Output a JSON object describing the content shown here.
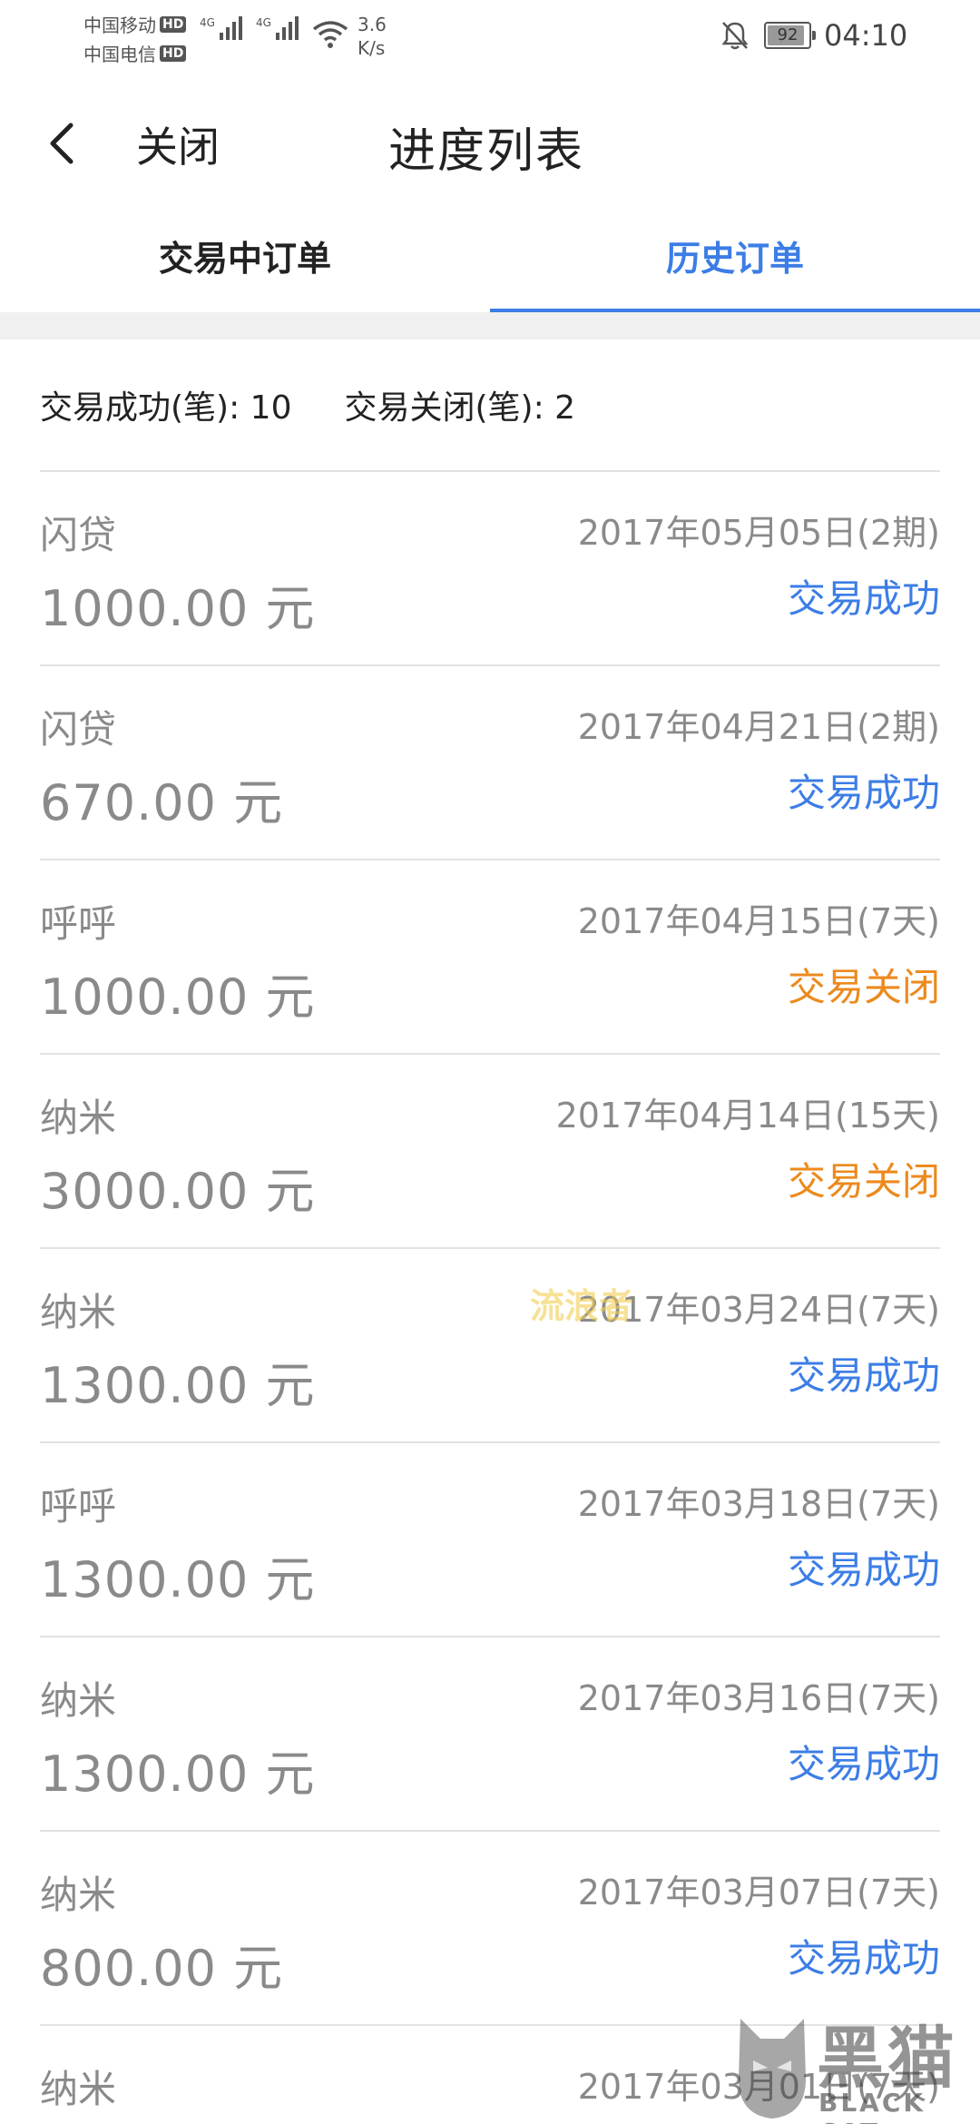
{
  "status_bar": {
    "carrier_1": "中国移动",
    "carrier_2": "中国电信",
    "hd_badge": "HD",
    "network_1": "4G",
    "network_2": "4G",
    "speed_value": "3.6",
    "speed_unit": "K/s",
    "battery": "92",
    "battery_level": 0.92,
    "time": "04:10"
  },
  "header": {
    "close_label": "关闭",
    "title": "进度列表"
  },
  "tabs": [
    {
      "label": "交易中订单",
      "active": false
    },
    {
      "label": "历史订单",
      "active": true
    }
  ],
  "summary": {
    "success_label": "交易成功(笔): 10",
    "closed_label": "交易关闭(笔): 2"
  },
  "orders": [
    {
      "name": "闪贷",
      "date": "2017年05月05日(2期)",
      "amount": "1000.00 元",
      "status": "交易成功",
      "status_type": "success"
    },
    {
      "name": "闪贷",
      "date": "2017年04月21日(2期)",
      "amount": "670.00 元",
      "status": "交易成功",
      "status_type": "success"
    },
    {
      "name": "呼呼",
      "date": "2017年04月15日(7天)",
      "amount": "1000.00 元",
      "status": "交易关闭",
      "status_type": "closed"
    },
    {
      "name": "纳米",
      "date": "2017年04月14日(15天)",
      "amount": "3000.00 元",
      "status": "交易关闭",
      "status_type": "closed"
    },
    {
      "name": "纳米",
      "date": "2017年03月24日(7天)",
      "amount": "1300.00 元",
      "status": "交易成功",
      "status_type": "success"
    },
    {
      "name": "呼呼",
      "date": "2017年03月18日(7天)",
      "amount": "1300.00 元",
      "status": "交易成功",
      "status_type": "success"
    },
    {
      "name": "纳米",
      "date": "2017年03月16日(7天)",
      "amount": "1300.00 元",
      "status": "交易成功",
      "status_type": "success"
    },
    {
      "name": "纳米",
      "date": "2017年03月07日(7天)",
      "amount": "800.00 元",
      "status": "交易成功",
      "status_type": "success"
    },
    {
      "name": "纳米",
      "date": "2017年03月01日(7天)",
      "amount": "",
      "status": "",
      "status_type": "success"
    }
  ],
  "watermarks": {
    "middle": "流浪者",
    "logo_cn": "黑猫",
    "logo_en": "BLACK CAT"
  },
  "colors": {
    "accent_blue": "#3c7de6",
    "closed_orange": "#ec8a1d",
    "muted_text": "#8a8a8a"
  },
  "icons": {
    "back": "chevron-left-icon",
    "wifi": "wifi-icon",
    "bell": "bell-off-icon",
    "battery": "battery-icon"
  }
}
